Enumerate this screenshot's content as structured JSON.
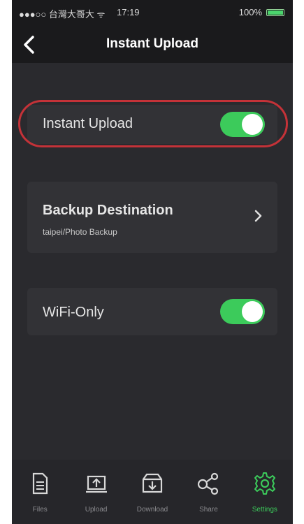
{
  "status": {
    "carrier": "●●●○○ 台灣大哥大 ᯤ",
    "time": "17:19",
    "battery": "100%"
  },
  "nav": {
    "title": "Instant Upload"
  },
  "settings": {
    "instant_upload": {
      "label": "Instant Upload",
      "enabled": true
    },
    "backup_destination": {
      "label": "Backup Destination",
      "value": "taipei/Photo Backup"
    },
    "wifi_only": {
      "label": "WiFi-Only",
      "enabled": true
    }
  },
  "tabs": [
    {
      "label": "Files",
      "icon": "file-icon",
      "active": false
    },
    {
      "label": "Upload",
      "icon": "upload-icon",
      "active": false
    },
    {
      "label": "Download",
      "icon": "download-icon",
      "active": false
    },
    {
      "label": "Share",
      "icon": "share-icon",
      "active": false
    },
    {
      "label": "Settings",
      "icon": "gear-icon",
      "active": true
    }
  ],
  "colors": {
    "accent": "#3ccb5b",
    "highlight": "#c43238",
    "background": "#2a2a2e"
  }
}
